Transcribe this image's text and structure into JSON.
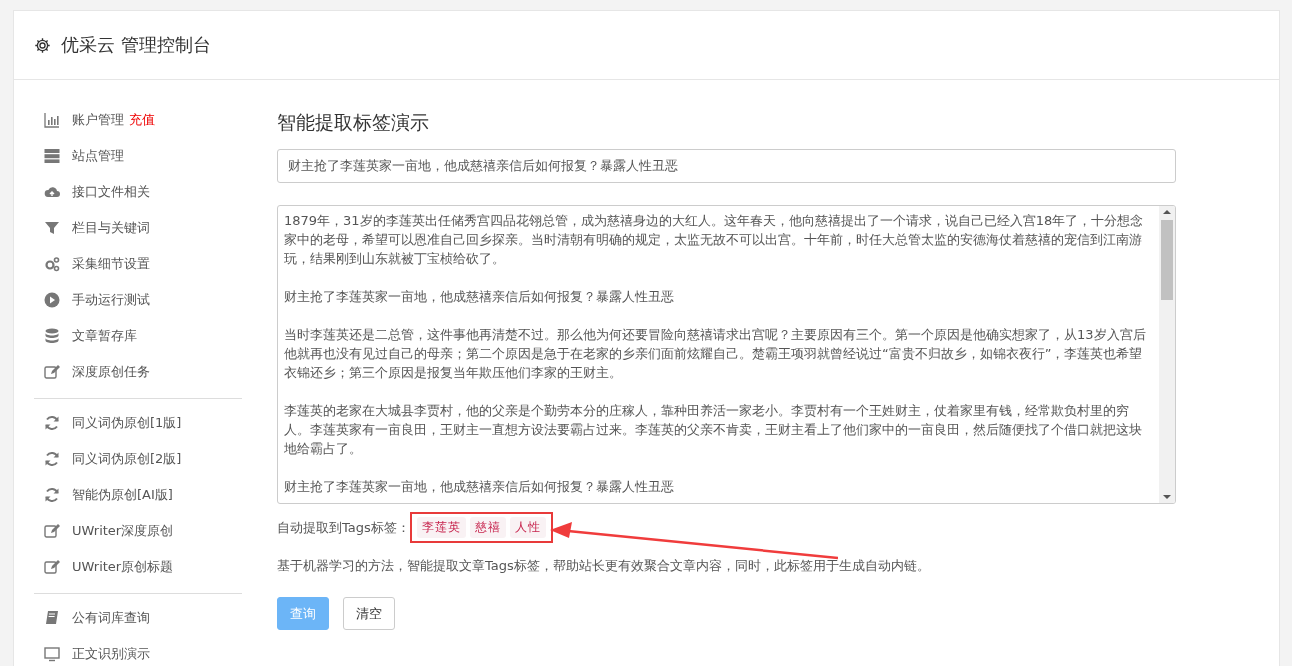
{
  "header": {
    "title": "优采云 管理控制台"
  },
  "sidebar": {
    "groups": [
      {
        "items": [
          {
            "label": "账户管理",
            "badge": "充值"
          },
          {
            "label": "站点管理"
          },
          {
            "label": "接口文件相关"
          },
          {
            "label": "栏目与关键词"
          },
          {
            "label": "采集细节设置"
          },
          {
            "label": "手动运行测试"
          },
          {
            "label": "文章暂存库"
          },
          {
            "label": "深度原创任务"
          }
        ]
      },
      {
        "items": [
          {
            "label": "同义词伪原创[1版]"
          },
          {
            "label": "同义词伪原创[2版]"
          },
          {
            "label": "智能伪原创[AI版]"
          },
          {
            "label": "UWriter深度原创"
          },
          {
            "label": "UWriter原创标题"
          }
        ]
      },
      {
        "items": [
          {
            "label": "公有词库查询"
          },
          {
            "label": "正文识别演示"
          }
        ]
      }
    ]
  },
  "main": {
    "title": "智能提取标签演示",
    "title_field": {
      "value": "财主抢了李莲英家一亩地，他成慈禧亲信后如何报复？暴露人性丑恶"
    },
    "content_paragraphs": [
      "1879年，31岁的李莲英出任储秀宫四品花翎总管，成为慈禧身边的大红人。这年春天，他向慈禧提出了一个请求，说自己已经入宫18年了，十分想念家中的老母，希望可以恩准自己回乡探亲。当时清朝有明确的规定，太监无故不可以出宫。十年前，时任大总管太监的安德海仗着慈禧的宠信到江南游玩，结果刚到山东就被丁宝桢给砍了。",
      "财主抢了李莲英家一亩地，他成慈禧亲信后如何报复？暴露人性丑恶",
      "当时李莲英还是二总管，这件事他再清楚不过。那么他为何还要冒险向慈禧请求出宫呢？主要原因有三个。第一个原因是他确实想家了，从13岁入宫后他就再也没有见过自己的母亲；第二个原因是急于在老家的乡亲们面前炫耀自己。楚霸王项羽就曾经说过“富贵不归故乡，如锦衣夜行”，李莲英也希望衣锦还乡；第三个原因是报复当年欺压他们李家的王财主。",
      "李莲英的老家在大城县李贾村，他的父亲是个勤劳本分的庄稼人，靠种田养活一家老小。李贾村有一个王姓财主，仗着家里有钱，经常欺负村里的穷人。李莲英家有一亩良田，王财主一直想方设法要霸占过来。李莲英的父亲不肯卖，王财主看上了他们家中的一亩良田，然后随便找了个借口就把这块地给霸占了。",
      "财主抢了李莲英家一亩地，他成慈禧亲信后如何报复？暴露人性丑恶"
    ],
    "tags_label": "自动提取到Tags标签：",
    "tags": [
      "李莲英",
      "慈禧",
      "人性"
    ],
    "description": "基于机器学习的方法，智能提取文章Tags标签，帮助站长更有效聚合文章内容，同时，此标签用于生成自动内链。",
    "buttons": [
      {
        "label": "查询",
        "kind": "primary"
      },
      {
        "label": "清空",
        "kind": "default"
      }
    ]
  }
}
